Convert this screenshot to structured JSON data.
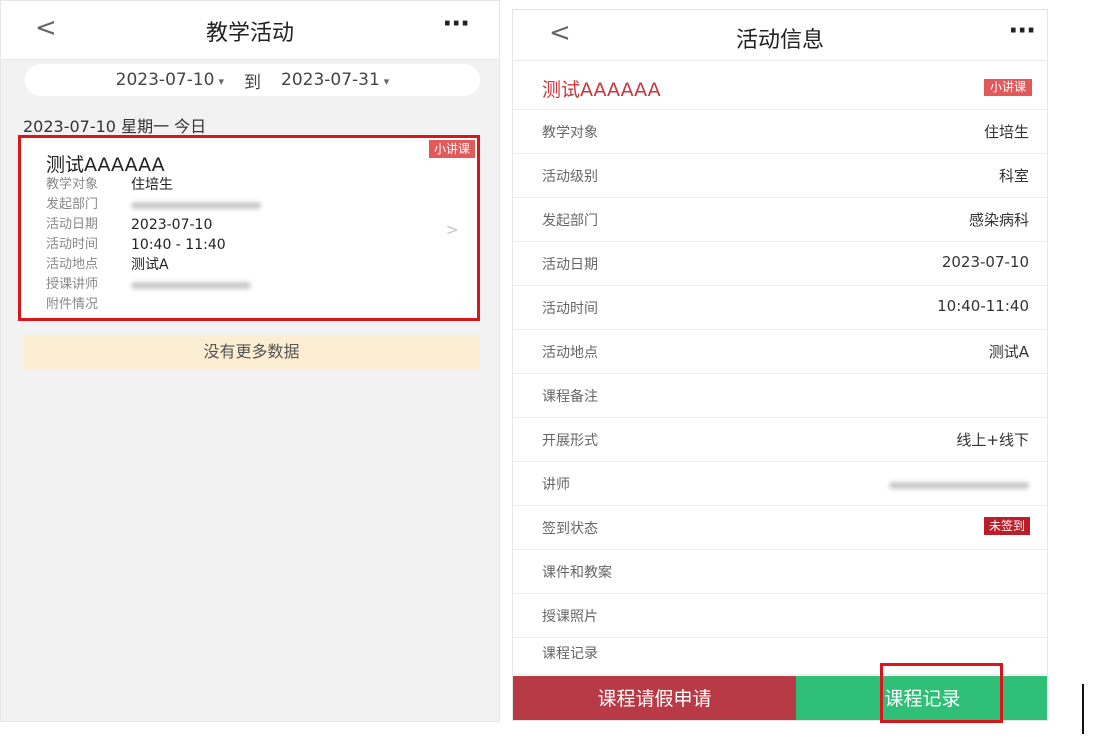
{
  "left": {
    "title": "教学活动",
    "back": "<",
    "more": "···",
    "date_start": "2023-07-10",
    "date_sep": "到",
    "date_end": "2023-07-31",
    "day_header": "2023-07-10 星期一 今日",
    "card": {
      "tag": "小讲课",
      "title": "测试AAAAAA",
      "rows": [
        {
          "k": "教学对象",
          "v": "住培生"
        },
        {
          "k": "发起部门",
          "v": ""
        },
        {
          "k": "活动日期",
          "v": "2023-07-10"
        },
        {
          "k": "活动时间",
          "v": "10:40 - 11:40"
        },
        {
          "k": "活动地点",
          "v": "测试A"
        },
        {
          "k": "授课讲师",
          "v": ""
        },
        {
          "k": "附件情况",
          "v": ""
        }
      ]
    },
    "no_more": "没有更多数据"
  },
  "right": {
    "title": "活动信息",
    "back": "<",
    "more": "···",
    "activity_title": "测试AAAAAA",
    "tag": "小讲课",
    "rows": [
      {
        "k": "教学对象",
        "v": "住培生"
      },
      {
        "k": "活动级别",
        "v": "科室"
      },
      {
        "k": "发起部门",
        "v": "感染病科"
      },
      {
        "k": "活动日期",
        "v": "2023-07-10"
      },
      {
        "k": "活动时间",
        "v": "10:40-11:40"
      },
      {
        "k": "活动地点",
        "v": "测试A"
      },
      {
        "k": "课程备注",
        "v": ""
      },
      {
        "k": "开展形式",
        "v": "线上+线下"
      },
      {
        "k": "讲师",
        "v": ""
      },
      {
        "k": "签到状态",
        "v": "未签到"
      },
      {
        "k": "课件和教案",
        "v": ""
      },
      {
        "k": "授课照片",
        "v": ""
      },
      {
        "k": "课程记录",
        "v": ""
      }
    ],
    "btn_leave": "课程请假申请",
    "btn_record": "课程记录"
  },
  "colors": {
    "tag_bg": "#e2595b",
    "title_red": "#c9363c",
    "leave_btn": "#b83a46",
    "record_btn": "#2fbf76",
    "highlight": "#d9161b"
  }
}
